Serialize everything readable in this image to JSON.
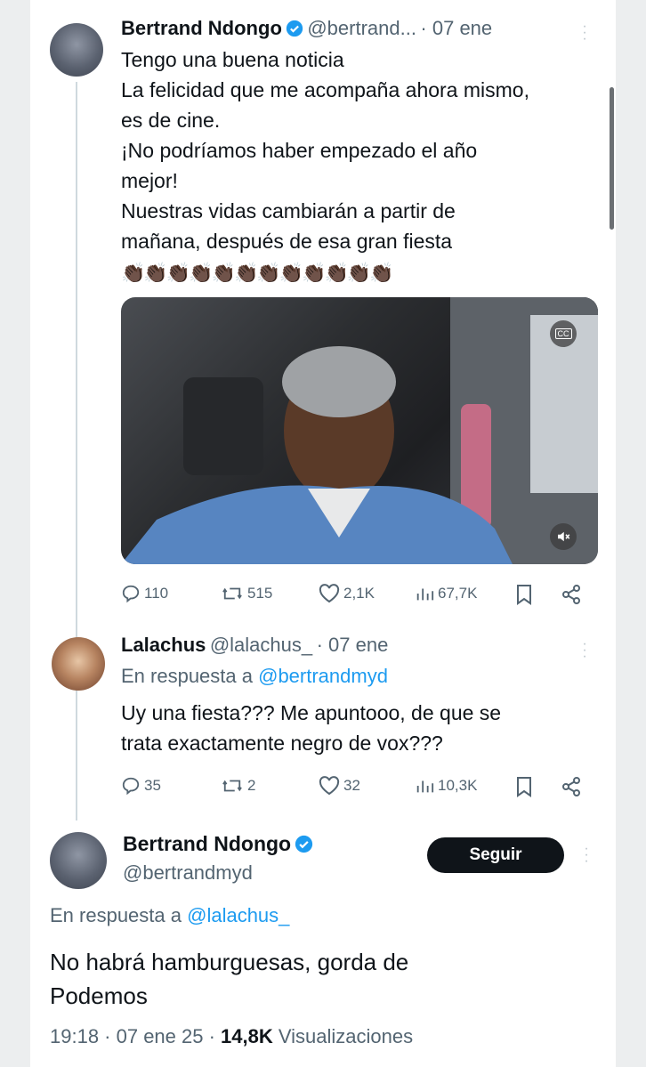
{
  "tweet1": {
    "author_name": "Bertrand Ndongo",
    "author_handle": "@bertrand...",
    "date": "· 07 ene",
    "text_lines": [
      "Tengo una buena noticia",
      "La felicidad que me acompaña ahora mismo,",
      "es de cine.",
      "¡No podríamos haber empezado el año",
      "mejor!",
      "Nuestras vidas cambiarán a partir de",
      "mañana, después de esa gran fiesta"
    ],
    "emoji_row": "👏🏿👏🏿👏🏿👏🏿👏🏿👏🏿👏🏿👏🏿👏🏿👏🏿👏🏿👏🏿",
    "media_cc_label": "CC",
    "stats": {
      "replies": "110",
      "retweets": "515",
      "likes": "2,1K",
      "views": "67,7K"
    }
  },
  "tweet2": {
    "author_name": "Lalachus",
    "author_handle": "@lalachus_",
    "date": "· 07 ene",
    "reply_prefix": "En respuesta a",
    "reply_to": "@bertrandmyd",
    "text_lines": [
      "Uy una fiesta??? Me apuntooo, de que se",
      "trata exactamente negro de vox???"
    ],
    "stats": {
      "replies": "35",
      "retweets": "2",
      "likes": "32",
      "views": "10,3K"
    }
  },
  "tweet3": {
    "author_name": "Bertrand Ndongo",
    "author_handle": "@bertrandmyd",
    "follow_label": "Seguir",
    "reply_prefix": "En respuesta a",
    "reply_to": "@lalachus_",
    "text_lines": [
      "No habrá hamburguesas, gorda de",
      "Podemos"
    ],
    "time": "19:18 · 07 ene 25 ·",
    "views_count": "14,8K",
    "views_label": "Visualizaciones"
  },
  "colors": {
    "link": "#1d9bf0",
    "muted": "#536471",
    "text": "#0f1419",
    "button": "#0f1419"
  }
}
